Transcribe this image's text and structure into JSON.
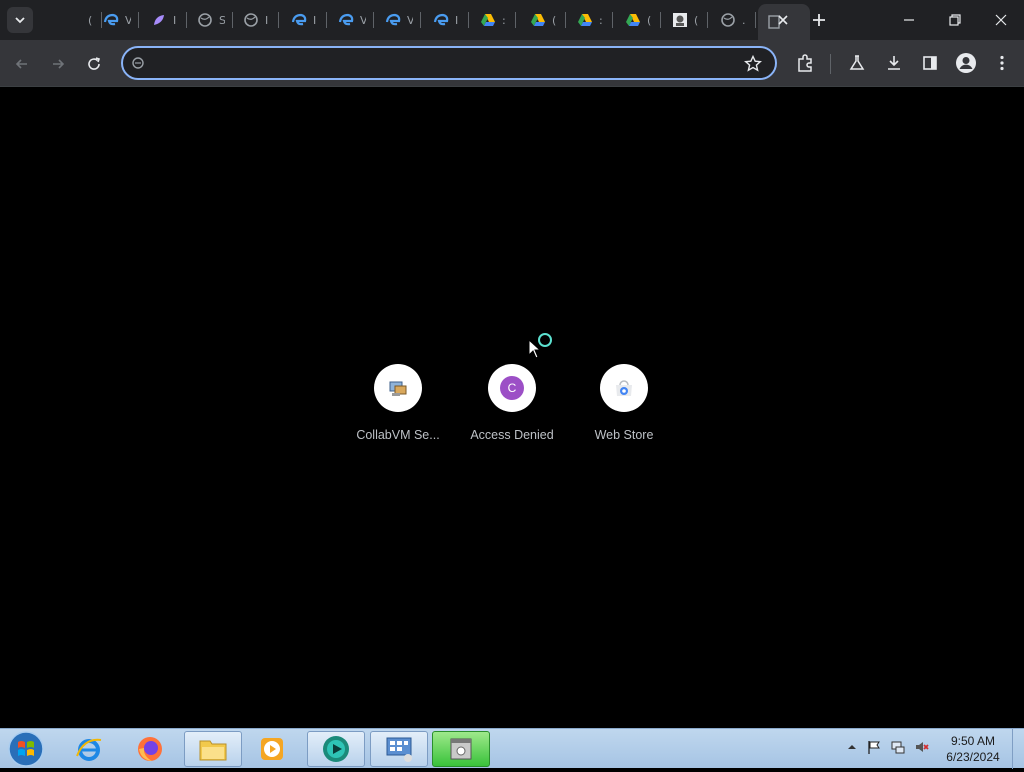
{
  "browser": {
    "tabs": [
      {
        "name": "tab-1",
        "icon": "page-icon",
        "title": "(",
        "color": "#9aa0a6"
      },
      {
        "name": "tab-2",
        "icon": "edge-icon",
        "title": "V",
        "color": "#4a9cf0"
      },
      {
        "name": "tab-3",
        "icon": "feather-icon",
        "title": "I",
        "color": "#a78bfa"
      },
      {
        "name": "tab-4",
        "icon": "globe-icon",
        "title": "S",
        "color": "#9aa0a6"
      },
      {
        "name": "tab-5",
        "icon": "globe-icon",
        "title": "I",
        "color": "#9aa0a6"
      },
      {
        "name": "tab-6",
        "icon": "edge-icon",
        "title": "I",
        "color": "#4a9cf0"
      },
      {
        "name": "tab-7",
        "icon": "edge-icon",
        "title": "V",
        "color": "#4a9cf0"
      },
      {
        "name": "tab-8",
        "icon": "edge-icon",
        "title": "V",
        "color": "#4a9cf0"
      },
      {
        "name": "tab-9",
        "icon": "edge-icon",
        "title": "I",
        "color": "#4a9cf0"
      },
      {
        "name": "tab-10",
        "icon": "drive-icon",
        "title": ":",
        "color": "#34a853"
      },
      {
        "name": "tab-11",
        "icon": "drive-icon",
        "title": "(",
        "color": "#34a853"
      },
      {
        "name": "tab-12",
        "icon": "drive-icon",
        "title": ":",
        "color": "#34a853"
      },
      {
        "name": "tab-13",
        "icon": "drive-icon",
        "title": "(",
        "color": "#34a853"
      },
      {
        "name": "tab-14",
        "icon": "photo-icon",
        "title": "(",
        "color": "#e8eaed"
      },
      {
        "name": "tab-15",
        "icon": "globe-icon",
        "title": ".",
        "color": "#9aa0a6"
      }
    ],
    "omnibox": {
      "value": "",
      "placeholder": ""
    }
  },
  "shortcuts": [
    {
      "label": "CollabVM Se...",
      "icon": "collabvm-icon"
    },
    {
      "label": "Access Denied",
      "icon": "letter-c-icon",
      "letter": "C"
    },
    {
      "label": "Web Store",
      "icon": "webstore-icon"
    }
  ],
  "taskbar": {
    "apps": [
      "internet-explorer-icon",
      "firefox-icon",
      "explorer-icon",
      "media-player-icon",
      "chrome-like-icon",
      "control-panel-icon",
      "app-window-icon"
    ],
    "clock_time": "9:50 AM",
    "clock_date": "6/23/2024"
  },
  "colors": {
    "accent": "#8ab4f8",
    "spinner": "#5ce0cf",
    "chrome_bg": "#202124",
    "toolbar_bg": "#35363a"
  }
}
